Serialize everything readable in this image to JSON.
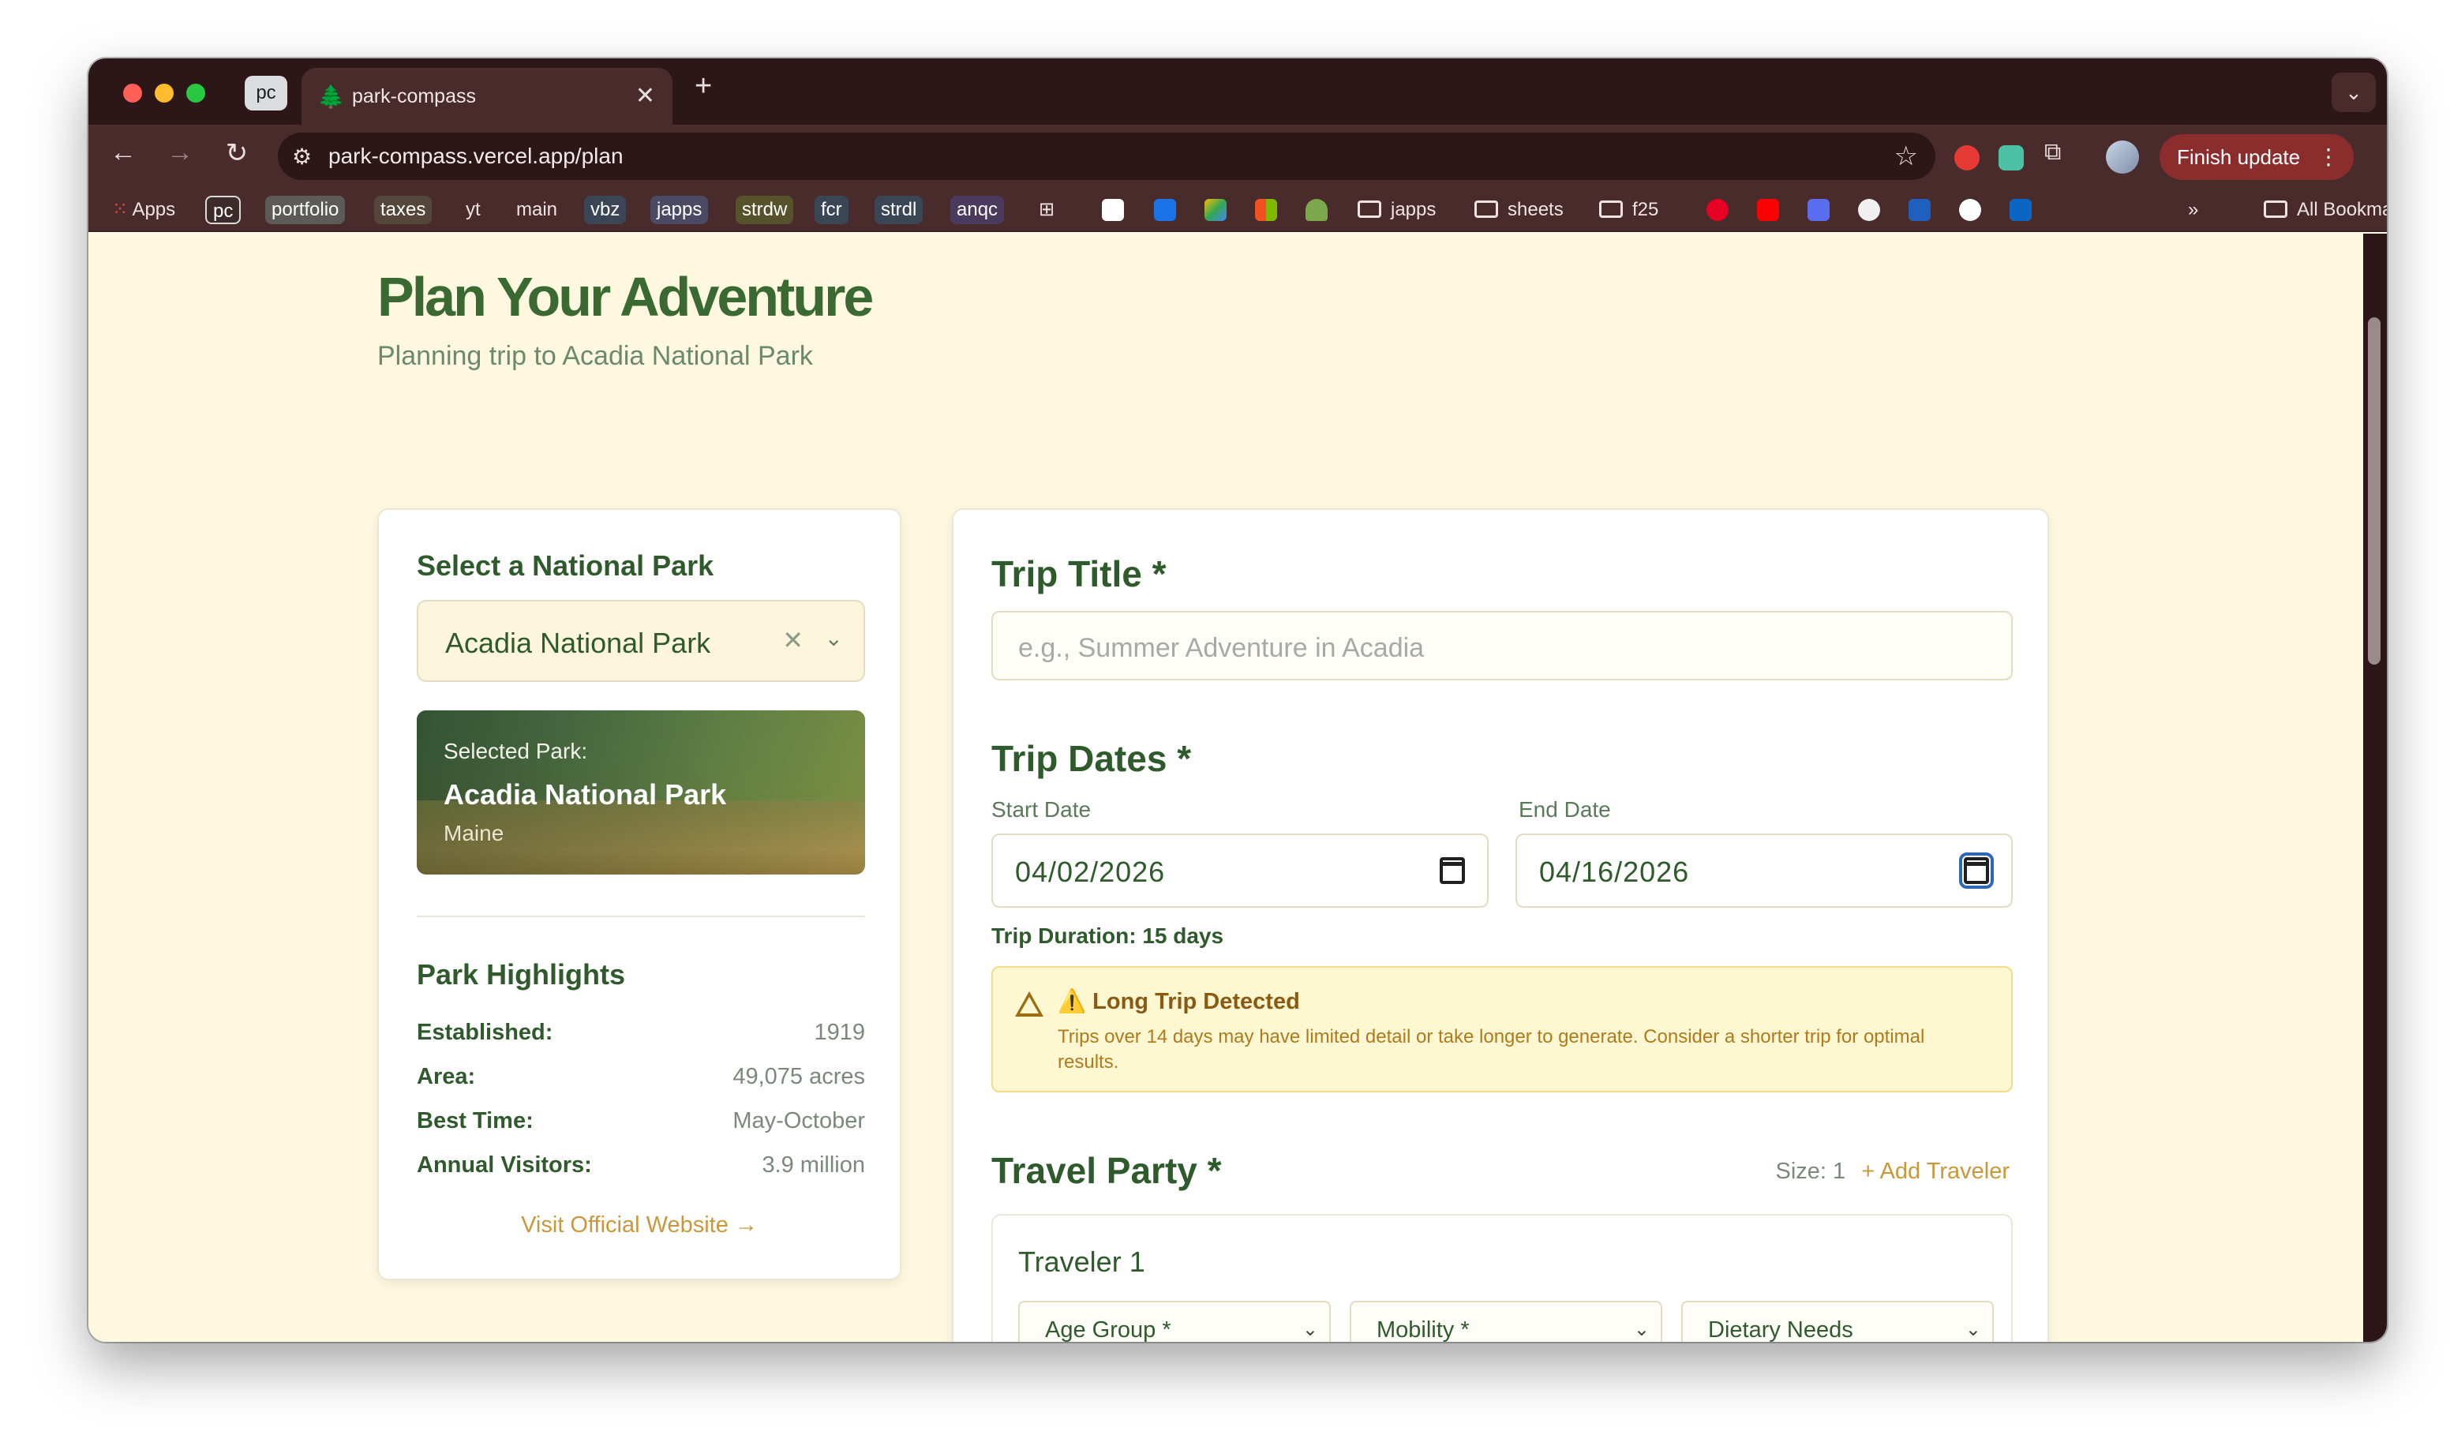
{
  "browser": {
    "tab_group_label": "pc",
    "tab_title": "park-compass",
    "url": "park-compass.vercel.app/plan",
    "finish_update_label": "Finish update",
    "bookmarks": {
      "apps": "Apps",
      "pc": "pc",
      "portfolio": "portfolio",
      "taxes": "taxes",
      "yt": "yt",
      "main": "main",
      "vbz": "vbz",
      "japps": "japps",
      "strdw": "strdw",
      "fcr": "fcr",
      "strdl": "strdl",
      "anqc": "anqc",
      "folder_japps": "japps",
      "folder_sheets": "sheets",
      "folder_f25": "f25",
      "more": "»",
      "all_bookmarks": "All Bookmarks"
    }
  },
  "page": {
    "title": "Plan Your Adventure",
    "subtitle": "Planning trip to Acadia National Park"
  },
  "park_panel": {
    "heading": "Select a National Park",
    "selected_value": "Acadia National Park",
    "image_label": "Selected Park:",
    "image_park_name": "Acadia National Park",
    "image_state": "Maine",
    "highlights_heading": "Park Highlights",
    "highlights": [
      {
        "key": "Established:",
        "value": "1919"
      },
      {
        "key": "Area:",
        "value": "49,075 acres"
      },
      {
        "key": "Best Time:",
        "value": "May-October"
      },
      {
        "key": "Annual Visitors:",
        "value": "3.9 million"
      }
    ],
    "website_link": "Visit Official Website →"
  },
  "trip_form": {
    "title_heading": "Trip Title *",
    "title_placeholder": "e.g., Summer Adventure in Acadia",
    "dates_heading": "Trip Dates *",
    "start_label": "Start Date",
    "start_value": "04/02/2026",
    "end_label": "End Date",
    "end_value": "04/16/2026",
    "duration": "Trip Duration: 15 days",
    "warning_title": "⚠️ Long Trip Detected",
    "warning_text": "Trips over 14 days may have limited detail or take longer to generate. Consider a shorter trip for optimal results.",
    "party_heading": "Travel Party *",
    "party_size": "Size: 1",
    "add_traveler": "+ Add Traveler",
    "traveler_title": "Traveler 1",
    "age_group": "Age Group *",
    "mobility": "Mobility *",
    "dietary": "Dietary Needs"
  },
  "colors": {
    "heading_green": "#3a6a32",
    "accent_gold": "#c9983a",
    "page_bg": "#fff8e1",
    "warning_bg": "#fef8d2"
  }
}
